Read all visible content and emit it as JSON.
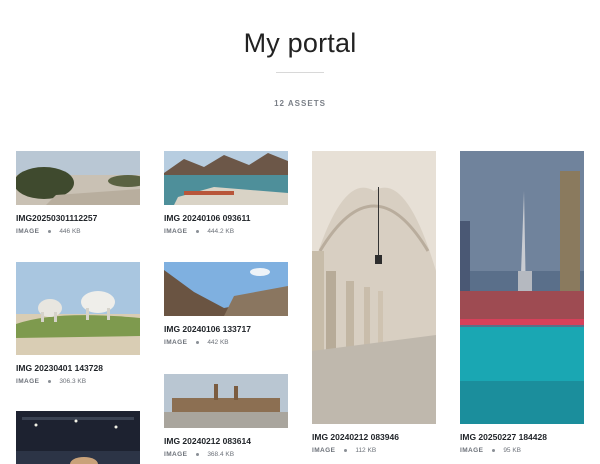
{
  "portal": {
    "title": "My portal",
    "asset_count": "12 ASSETS"
  },
  "assets": [
    {
      "name": "IMG20250301112257",
      "type": "IMAGE",
      "size": "446 KB"
    },
    {
      "name": "IMG 20230401 143728",
      "type": "IMAGE",
      "size": "306.3 KB"
    },
    {
      "name": "IMG 20240106 093611",
      "type": "IMAGE",
      "size": "444.2 KB"
    },
    {
      "name": "IMG 20240106 133717",
      "type": "IMAGE",
      "size": "442 KB"
    },
    {
      "name": "IMG 20240212 083614",
      "type": "IMAGE",
      "size": "368.4 KB"
    },
    {
      "name": "IMG 20240212 083946",
      "type": "IMAGE",
      "size": "112 KB"
    },
    {
      "name": "IMG 20250227 184428",
      "type": "IMAGE",
      "size": "95 KB"
    }
  ]
}
